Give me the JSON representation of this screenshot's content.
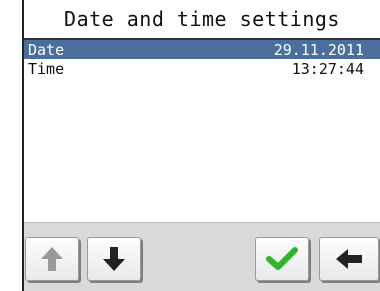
{
  "window": {
    "title": "Date and time settings"
  },
  "settings": {
    "items": [
      {
        "label": "Date",
        "value": "29.11.2011",
        "selected": true
      },
      {
        "label": "Time",
        "value": "13:27:44",
        "selected": false
      }
    ]
  },
  "toolbar": {
    "buttons": [
      {
        "icon": "arrow-up-icon",
        "state": "disabled"
      },
      {
        "icon": "arrow-down-icon",
        "state": "enabled"
      },
      {
        "icon": "checkmark-icon",
        "state": "enabled"
      },
      {
        "icon": "arrow-left-icon",
        "state": "enabled"
      }
    ]
  },
  "colors": {
    "selection": "#4a6f9c",
    "toolbar_bg": "#d9d9d9",
    "check_green": "#2fb52a",
    "arrow_dark": "#222222",
    "arrow_disabled": "#9a9a9a"
  }
}
